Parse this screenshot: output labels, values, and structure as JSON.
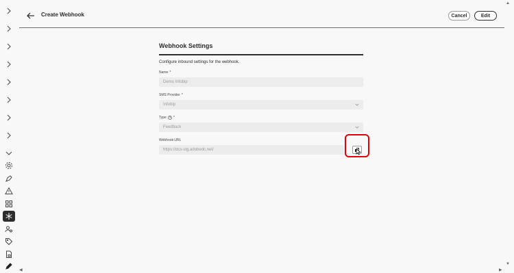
{
  "header": {
    "title": "Create Webhook",
    "cancel_label": "Cancel",
    "edit_label": "Edit"
  },
  "form": {
    "section_title": "Webhook Settings",
    "description": "Configure inbound settings for the webhook.",
    "name_label": "Name",
    "name_value": "Demo Infobip",
    "provider_label": "SMS Provider",
    "provider_value": "Infobip",
    "type_label": "Type",
    "type_value": "Feedback",
    "url_label": "Webhook URL",
    "url_value": "https://dcs-stg.adobedc.net/",
    "required_mark": "*"
  },
  "rail": {
    "icons": [
      "chevron-right-icon",
      "chevron-right-icon",
      "chevron-right-icon",
      "chevron-right-icon",
      "chevron-right-icon",
      "chevron-right-icon",
      "chevron-right-icon",
      "chevron-right-icon",
      "chevron-down-icon",
      "gear-icon",
      "pen-icon",
      "alert-triangle-icon",
      "grid-icon",
      "snowflake-icon",
      "users-icon",
      "tag-icon",
      "doc-lock-icon",
      "pencil-icon"
    ],
    "active_icon": "snowflake-icon"
  },
  "colors": {
    "highlight": "#e3000b",
    "text": "#2c2c2c",
    "field": "#ececec"
  }
}
